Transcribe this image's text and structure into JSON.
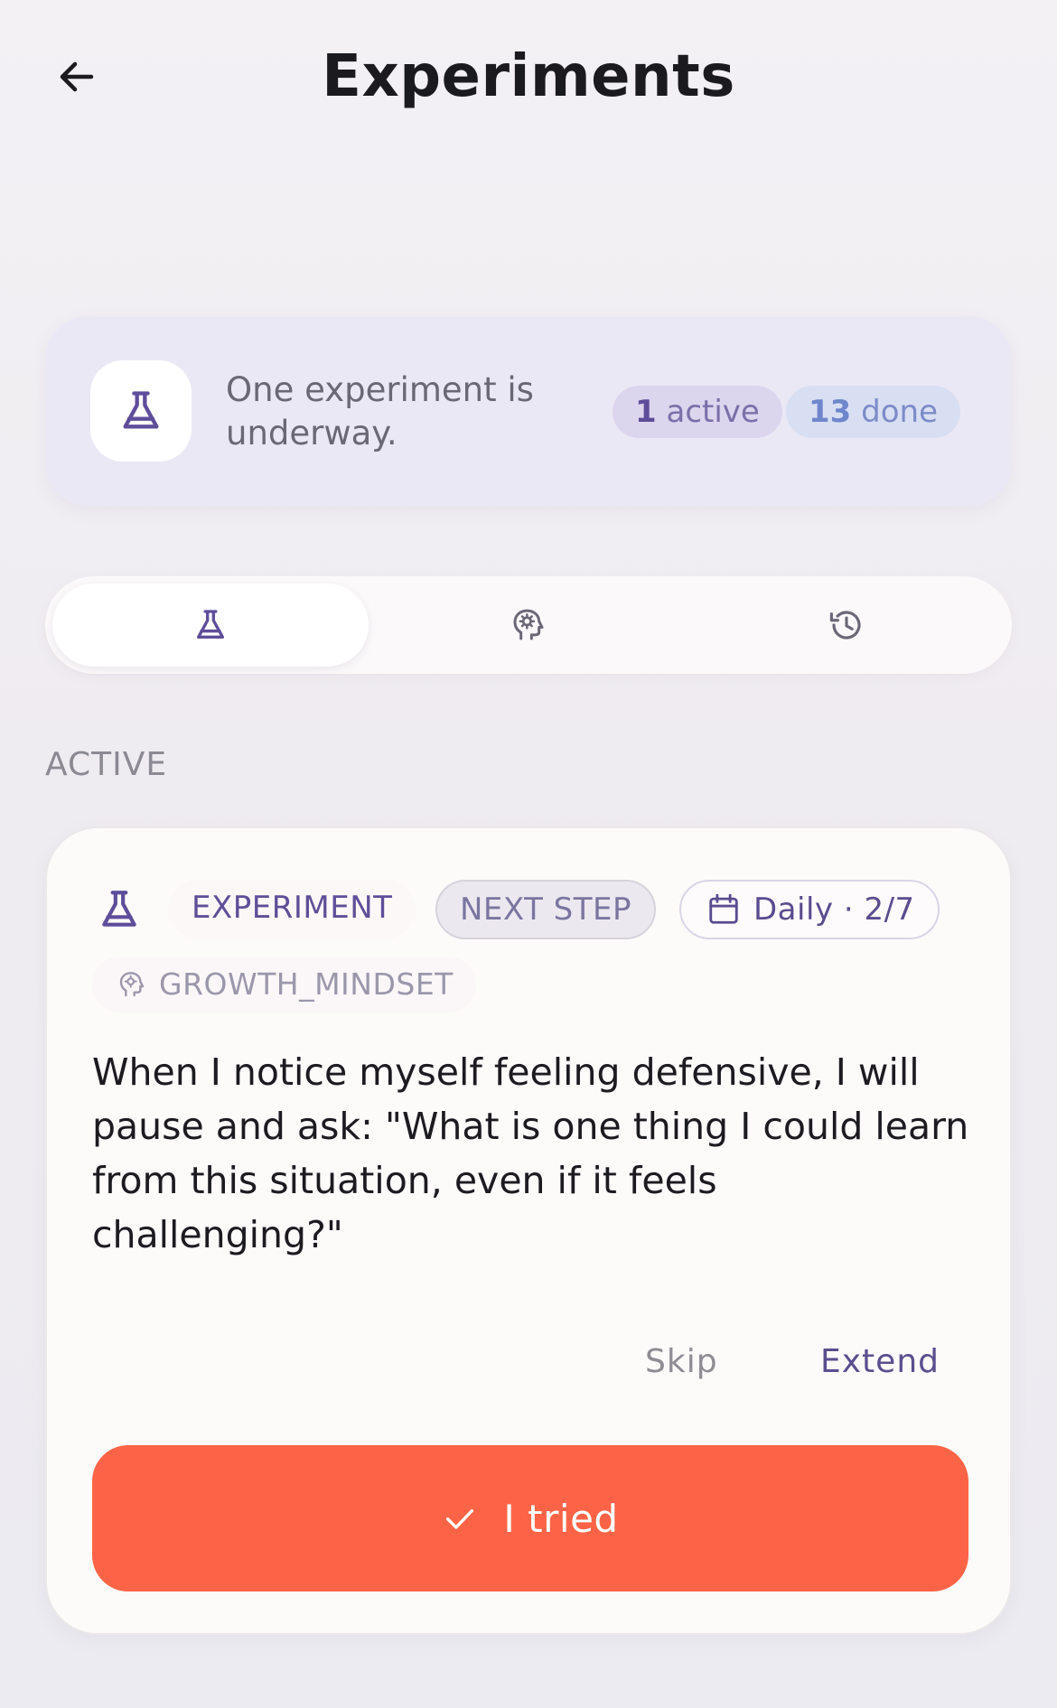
{
  "header": {
    "title": "Experiments",
    "back_icon": "arrow-left-icon"
  },
  "summary": {
    "icon": "flask-icon",
    "message": "One experiment is underway.",
    "active_count": "1",
    "active_label": "active",
    "done_count": "13",
    "done_label": "done"
  },
  "tabs": [
    {
      "icon": "flask-icon",
      "selected": true
    },
    {
      "icon": "brain-gear-icon",
      "selected": false
    },
    {
      "icon": "history-icon",
      "selected": false
    }
  ],
  "section": {
    "label": "ACTIVE"
  },
  "experiment": {
    "type_tag": "EXPERIMENT",
    "step_tag": "NEXT STEP",
    "schedule_tag": "Daily · 2/7",
    "category_tag": "GROWTH_MINDSET",
    "statement": "When I notice myself feeling defensive, I will pause and ask: \"What is one thing I could learn from this situation, even if it feels challenging?\"",
    "skip_label": "Skip",
    "extend_label": "Extend",
    "primary_label": "I tried"
  },
  "colors": {
    "accent": "#fd6447",
    "brand_purple": "#5e4d9a",
    "summary_bg": "#ebe8f5"
  }
}
